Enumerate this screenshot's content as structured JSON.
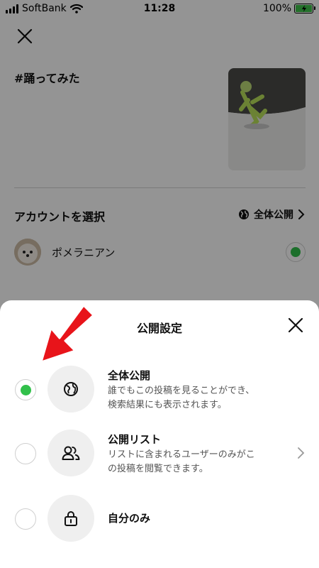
{
  "status_bar": {
    "carrier": "SoftBank",
    "time": "11:28",
    "battery": "100%"
  },
  "post": {
    "title": "#踊ってみた"
  },
  "account_section": {
    "label": "アカウントを選択",
    "visibility": "全体公開",
    "account_name": "ポメラニアン"
  },
  "sheet": {
    "title": "公開設定",
    "options": [
      {
        "title": "全体公開",
        "desc_line1": "誰でもこの投稿を見ることができ、",
        "desc_line2": "検索結果にも表示されます。",
        "selected": true,
        "icon": "globe-icon"
      },
      {
        "title": "公開リスト",
        "desc_line1": "リストに含まれるユーザーのみがこ",
        "desc_line2": "の投稿を閲覧できます。",
        "selected": false,
        "icon": "users-icon"
      },
      {
        "title": "自分のみ",
        "selected": false,
        "icon": "lock-icon"
      }
    ]
  },
  "colors": {
    "accent_green": "#31c04a",
    "annotation_red": "#e8141a"
  }
}
